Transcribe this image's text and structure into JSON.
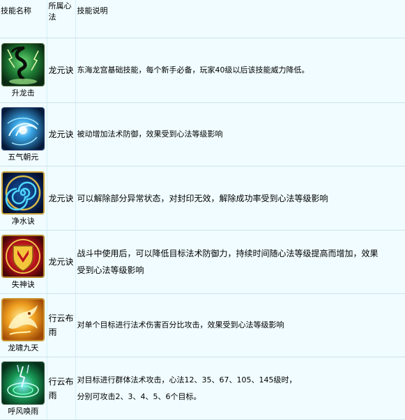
{
  "header": {
    "col_name": "技能名称",
    "col_xinfa": "所属心法",
    "col_desc": "技能说明"
  },
  "skills": [
    {
      "name": "升龙击",
      "icon": "dragon-lightning-icon",
      "xinfa": "龙元诀",
      "desc_lines": [
        "东海龙宫基础技能，每个新手必备，玩家40级以后该技能威力降低。"
      ]
    },
    {
      "name": "五气朝元",
      "icon": "blue-energy-swirl-icon",
      "xinfa": "龙元诀",
      "desc_lines": [
        "被动增加法术防御，效果受到心法等级影响"
      ]
    },
    {
      "name": "净水诀",
      "icon": "water-spiral-icon",
      "xinfa": "龙元诀",
      "desc_lines": [
        "可以解除部分异常状态，对封印无效，解除成功率受到心法等级影响"
      ]
    },
    {
      "name": "失神诀",
      "icon": "red-shield-icon",
      "xinfa": "龙元诀",
      "desc_lines": [
        "战斗中使用后，可以降低目标法术防御力，持续时间随心法等级提高而增加，效果",
        "受到心法等级影响"
      ]
    },
    {
      "name": "龙啸九天",
      "icon": "golden-dragon-icon",
      "xinfa_lines": [
        "行云布",
        "雨"
      ],
      "desc_lines": [
        "对单个目标进行法术伤害百分比攻击，效果受到心法等级影响"
      ]
    },
    {
      "name": "呼风唤雨",
      "icon": "green-whirlwind-icon",
      "xinfa_lines": [
        "行云布",
        "雨"
      ],
      "desc_lines": [
        "对目标进行群体法术攻击，心法12、35、67、105、145级时，",
        "分别可攻击2、3、4、5、6个目标。"
      ]
    }
  ]
}
